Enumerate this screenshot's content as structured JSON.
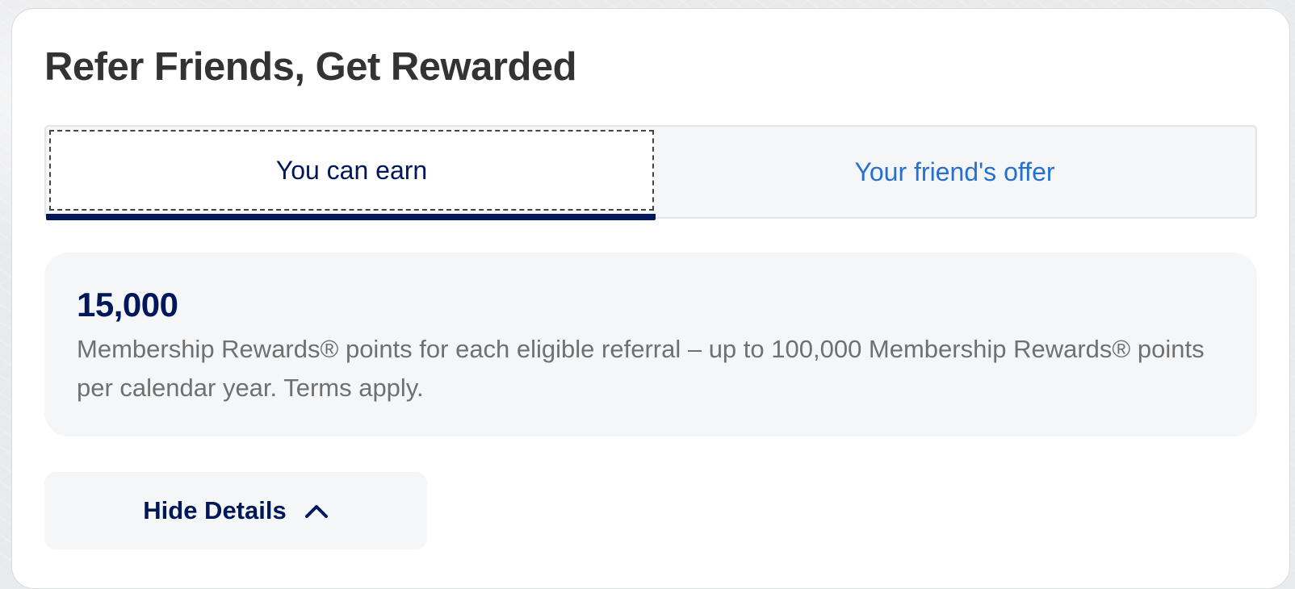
{
  "card": {
    "title": "Refer Friends, Get Rewarded"
  },
  "tabs": [
    {
      "label": "You can earn",
      "selected": true
    },
    {
      "label": "Your friend's offer",
      "selected": false
    }
  ],
  "offer": {
    "points": "15,000",
    "description": "Membership Rewards® points for each eligible referral – up to 100,000 Membership Rewards® points per calendar year. Terms apply."
  },
  "details_toggle": {
    "label": "Hide Details",
    "icon": "chevron-up-icon"
  },
  "colors": {
    "navy": "#00175a",
    "link_blue": "#2671d0",
    "panel_bg": "#f4f6f8",
    "body_text": "#707070",
    "title_text": "#333333"
  }
}
